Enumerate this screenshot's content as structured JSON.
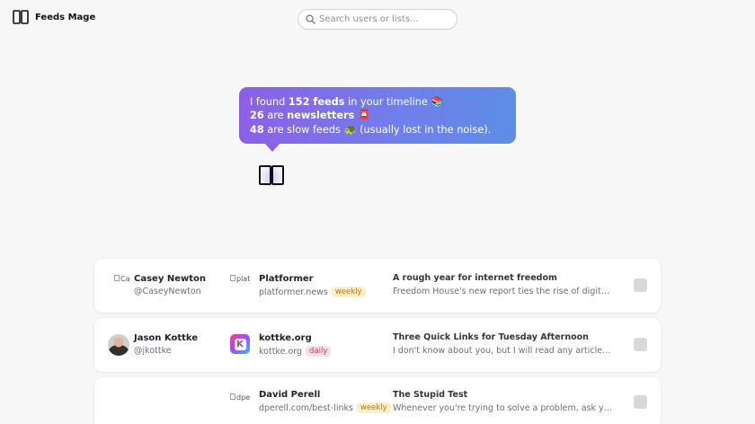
{
  "app": {
    "name": "Feeds Mage",
    "logo_icon": "open-book-icon"
  },
  "search": {
    "placeholder": "Search users or lists...",
    "icon": "search-icon"
  },
  "summary": {
    "line1": {
      "pre": "I found ",
      "value": "152 feeds",
      "post": " in your timeline ",
      "emoji": "📚"
    },
    "line2": {
      "value": "26",
      "mid": " are ",
      "bold": "newsletters",
      "emoji": "📮"
    },
    "line3": {
      "value": "48",
      "post": " are slow feeds ",
      "emoji": "🐢",
      "tail": " (usually lost in the noise)."
    },
    "mascot_icon": "open-book-icon"
  },
  "rows": [
    {
      "user": {
        "name": "Casey Newton",
        "handle": "@CaseyNewton",
        "avatar_alt": "Casey",
        "avatar": "broken-image"
      },
      "feed": {
        "name": "Platformer",
        "url": "platformer.news",
        "frequency": "weekly",
        "logo_alt": "platf",
        "logo": "broken-image"
      },
      "post": {
        "title": "A rough year for internet freedom",
        "excerpt": "Freedom House's new report ties the rise of digital authoritarianism"
      }
    },
    {
      "user": {
        "name": "Jason Kottke",
        "handle": "@jkottke",
        "avatar": "photo"
      },
      "feed": {
        "name": "kottke.org",
        "url": "kottke.org",
        "frequency": "daily",
        "logo": "kottke-logo"
      },
      "post": {
        "title": "Three Quick Links for Tuesday Afternoon",
        "excerpt": "I don't know about you, but I will read any article titled something"
      }
    },
    {
      "user": {
        "name": "",
        "handle": ""
      },
      "feed": {
        "name": "David Perell",
        "url": "dperell.com/best-links",
        "frequency": "weekly",
        "logo_alt": "dpe",
        "logo": "broken-image"
      },
      "post": {
        "title": "The Stupid Test",
        "excerpt": "Whenever you're trying to solve a problem, ask yourself: what would"
      }
    }
  ],
  "colors": {
    "bubble_start": "#8d5fe6",
    "bubble_end": "#5d8de6",
    "weekly_badge": "#fdf0c8",
    "daily_badge": "#fbe0ea",
    "page_bg": "#f7f7f8"
  }
}
